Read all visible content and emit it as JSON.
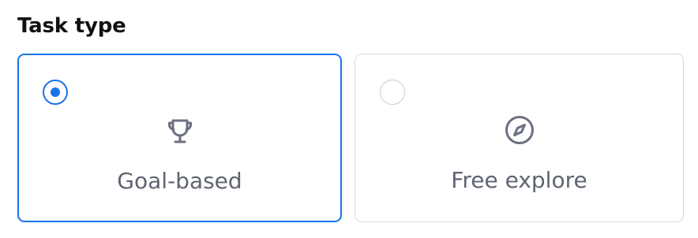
{
  "section": {
    "title": "Task type"
  },
  "options": [
    {
      "label": "Goal-based",
      "icon": "trophy-icon",
      "selected": true
    },
    {
      "label": "Free explore",
      "icon": "compass-icon",
      "selected": false
    }
  ],
  "colors": {
    "accent": "#1a73e8",
    "icon": "#6b6f82",
    "label": "#5f6472",
    "title": "#111111",
    "border_unselected": "#d7d9de"
  }
}
